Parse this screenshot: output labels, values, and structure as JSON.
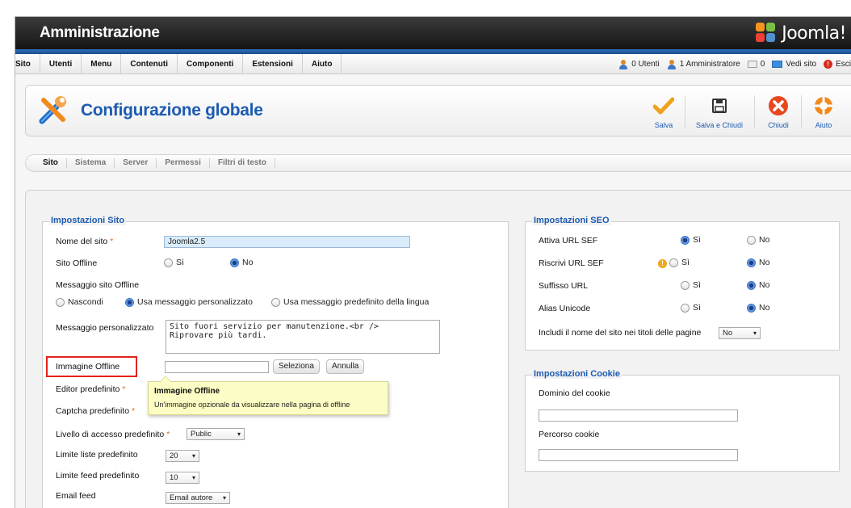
{
  "header": {
    "title": "Amministrazione",
    "logo_text": "Joomla!"
  },
  "menu": {
    "items": [
      "Sito",
      "Utenti",
      "Menu",
      "Contenuti",
      "Componenti",
      "Estensioni",
      "Aiuto"
    ]
  },
  "status": {
    "users": "0 Utenti",
    "admins": "1 Amministratore",
    "messages": "0",
    "view_site": "Vedi sito",
    "logout": "Esci"
  },
  "toolbar": {
    "title": "Configurazione globale",
    "save": "Salva",
    "save_close": "Salva e Chiudi",
    "close": "Chiudi",
    "help": "Aiuto"
  },
  "tabs": [
    "Sito",
    "Sistema",
    "Server",
    "Permessi",
    "Filtri di testo"
  ],
  "site_settings": {
    "legend": "Impostazioni Sito",
    "site_name_label": "Nome del sito",
    "required_mark": "*",
    "site_name_value": "Joomla2.5",
    "offline_label": "Sito Offline",
    "yes": "Sì",
    "no": "No",
    "offline_message_label": "Messaggio sito Offline",
    "msg_hide": "Nascondi",
    "msg_custom": "Usa messaggio personalizzato",
    "msg_default": "Usa messaggio predefinito della lingua",
    "custom_message_label": "Messaggio personalizzato",
    "custom_message_line1": "Sito fuori servizio per manutenzione.<br />",
    "custom_message_line2": "Riprovare più tardi.",
    "offline_image_label": "Immagine Offline",
    "select_button": "Seleziona",
    "cancel_button": "Annulla",
    "editor_label": "Editor predefinito",
    "captcha_label": "Captcha predefinito",
    "access_label": "Livello di accesso predefinito",
    "access_value": "Public",
    "list_limit_label": "Limite liste predefinito",
    "list_limit_value": "20",
    "feed_limit_label": "Limite feed predefinito",
    "feed_limit_value": "10",
    "email_feed_label": "Email feed",
    "email_feed_value": "Email autore"
  },
  "tooltip": {
    "title": "Immagine Offline",
    "text": "Un'immagine opzionale da visualizzare nella pagina di offline"
  },
  "seo": {
    "legend": "Impostazioni SEO",
    "sef_urls": "Attiva URL SEF",
    "url_rewrite": "Riscrivi URL SEF",
    "url_suffix": "Suffisso URL",
    "unicode_aliases": "Alias Unicode",
    "site_name_in_titles": "Includi il nome del sito nei titoli delle pagine",
    "site_name_in_titles_value": "No",
    "yes": "Sì",
    "no": "No",
    "values": {
      "sef_urls": "yes",
      "url_rewrite": "no",
      "url_suffix": "no",
      "unicode_aliases": "no"
    }
  },
  "cookie": {
    "legend": "Impostazioni Cookie",
    "domain_label": "Dominio del cookie",
    "path_label": "Percorso cookie"
  },
  "colors": {
    "accent": "#1d5bb1",
    "header": "#1f1f1f",
    "strip": "#2f6fb6",
    "highlight": "#e2231a"
  }
}
